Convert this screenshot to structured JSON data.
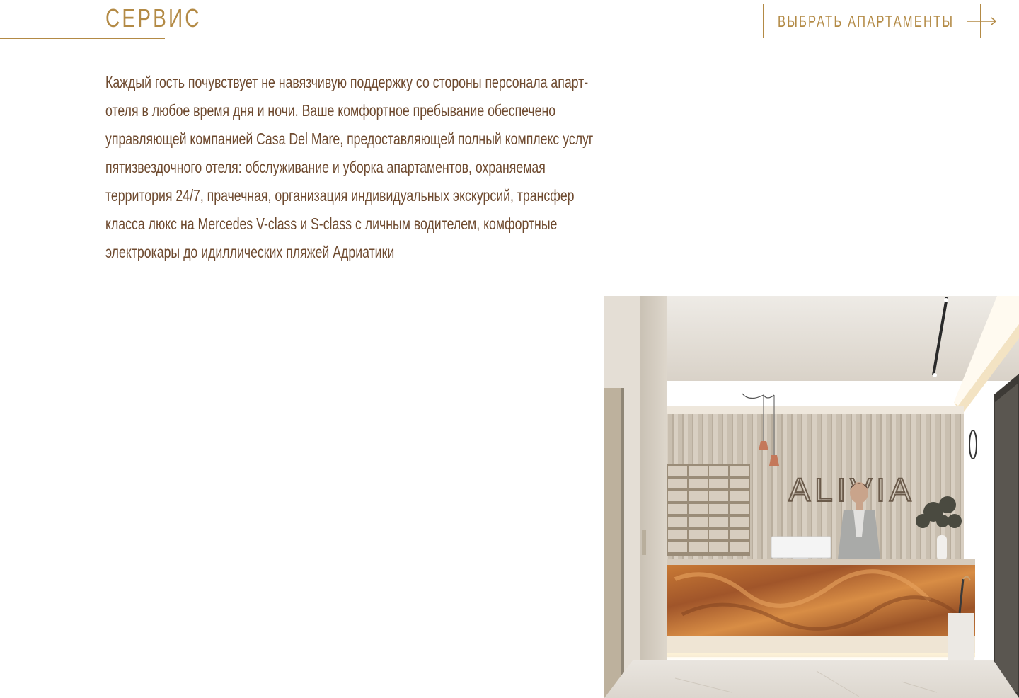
{
  "section": {
    "title": "СЕРВИС"
  },
  "cta": {
    "label": "ВЫБРАТЬ АПАРТАМЕНТЫ",
    "arrow_icon": "arrow-right-icon"
  },
  "description": {
    "text": "Каждый гость почувствует не навязчивую поддержку со стороны персонала апарт-отеля в любое время дня и ночи. Ваше комфортное пребывание обеспечено управляющей компанией Casa Del Mare, предоставляющей полный комплекс услуг пятизвездочного отеля: обслуживание и уборка апартаментов, охраняемая территория 24/7, прачечная, организация индивидуальных экскурсий, трансфер класса люкс на Mercedes V-class и S-class с личным водителем, комфортные электрокары до идиллических пляжей Адриатики"
  },
  "image": {
    "sign_text": "ALIVIA"
  },
  "colors": {
    "accent": "#b38a45",
    "text": "#6e4a2f",
    "background": "#ffffff"
  }
}
